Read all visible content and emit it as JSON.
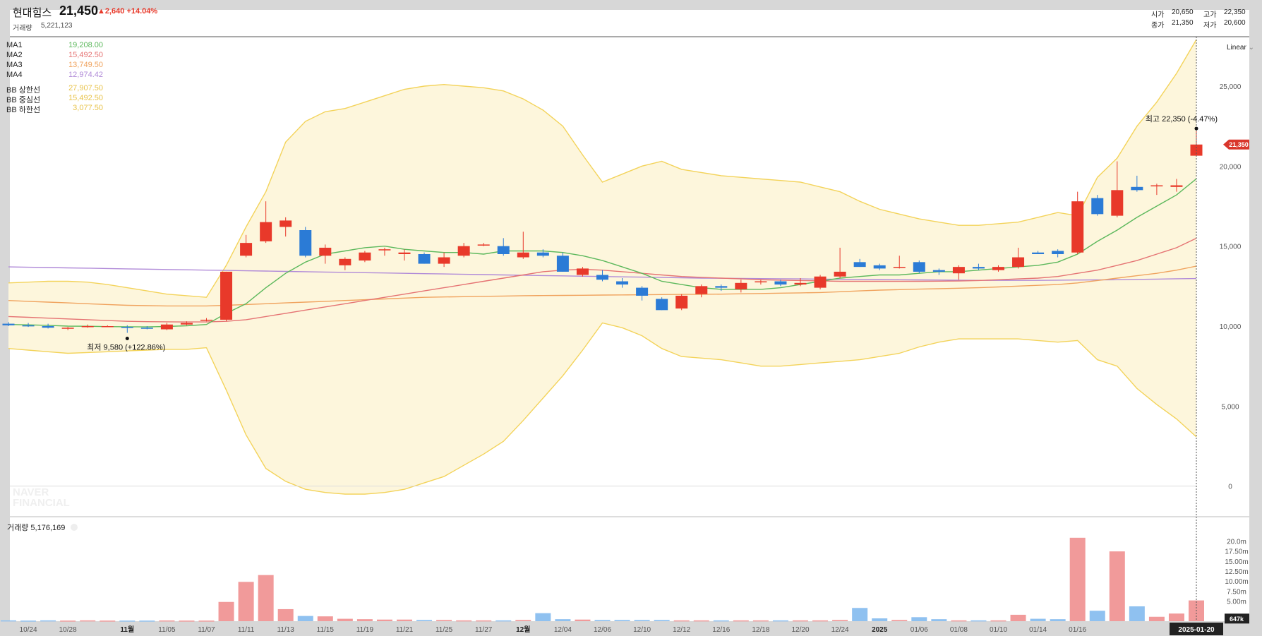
{
  "header": {
    "name": "현대힘스",
    "price": "21,450",
    "change": "▲2,640 +14.04%",
    "volume_label": "거래량",
    "volume_value": "5,221,123",
    "ohlc": {
      "open_label": "시가",
      "open": "20,650",
      "high_label": "고가",
      "high": "22,350",
      "close_label": "종가",
      "close": "21,350",
      "low_label": "저가",
      "low": "20,600"
    },
    "scale_mode": "Linear"
  },
  "legend": [
    {
      "name": "MA1",
      "value": "19,208.00",
      "color": "#5cb85c"
    },
    {
      "name": "MA2",
      "value": "15,492.50",
      "color": "#e57373"
    },
    {
      "name": "MA3",
      "value": "13,749.50",
      "color": "#f0a35e"
    },
    {
      "name": "MA4",
      "value": "12,974.42",
      "color": "#b08ad8"
    },
    {
      "name": "BB 상한선",
      "value": "27,907.50",
      "color": "#e8c34a"
    },
    {
      "name": "BB 중심선",
      "value": "15,492.50",
      "color": "#e8c34a"
    },
    {
      "name": "BB 하한선",
      "value": "3,077.50",
      "color": "#e8c34a"
    }
  ],
  "annotations": {
    "high": "최고 22,350 (-4.47%)",
    "low": "최저 9,580 (+122.86%)",
    "last_price_tag": "21,350",
    "volume_tag": "647k",
    "date_tag": "2025-01-20"
  },
  "volume_panel_label": "거래량 5,176,169",
  "watermark": [
    "NAVER",
    "FINANCIAL"
  ],
  "colors": {
    "up": "#e8392a",
    "down": "#2b7bd6",
    "band_fill": "#fdf6dc",
    "band_line": "#f3d35a"
  },
  "chart_data": {
    "type": "candlestick",
    "price_axis": {
      "ylim": [
        -500,
        28000
      ],
      "ticks": [
        0,
        5000,
        10000,
        15000,
        20000,
        25000
      ],
      "tick_labels": [
        "0",
        "5,000",
        "10,000",
        "15,000",
        "20,000",
        "25,000"
      ]
    },
    "volume_axis": {
      "ylim": [
        0,
        22000000
      ],
      "ticks": [
        5000000,
        7500000,
        10000000,
        12500000,
        15000000,
        17500000,
        20000000
      ],
      "tick_labels": [
        "5.00m",
        "7.50m",
        "10.00m",
        "12.50m",
        "15.00m",
        "17.50m",
        "20.0m"
      ]
    },
    "x_tick_labels": [
      "10/24",
      "10/28",
      "11월",
      "11/05",
      "11/07",
      "11/11",
      "11/13",
      "11/15",
      "11/19",
      "11/21",
      "11/25",
      "11/27",
      "12월",
      "12/04",
      "12/06",
      "12/10",
      "12/12",
      "12/16",
      "12/18",
      "12/20",
      "12/24",
      "2025",
      "01/06",
      "01/08",
      "01/10",
      "01/14",
      "01/16"
    ],
    "x_tick_index": [
      1,
      3,
      6,
      8,
      10,
      12,
      14,
      16,
      18,
      20,
      22,
      24,
      26,
      28,
      30,
      32,
      34,
      36,
      38,
      40,
      42,
      44,
      46,
      48,
      50,
      52,
      54
    ],
    "candles": [
      {
        "o": 10150,
        "h": 10250,
        "l": 10000,
        "c": 10050
      },
      {
        "o": 10050,
        "h": 10200,
        "l": 9950,
        "c": 10000
      },
      {
        "o": 10000,
        "h": 10150,
        "l": 9850,
        "c": 9900
      },
      {
        "o": 9850,
        "h": 9950,
        "l": 9750,
        "c": 9900
      },
      {
        "o": 9950,
        "h": 10100,
        "l": 9900,
        "c": 10000
      },
      {
        "o": 10000,
        "h": 10050,
        "l": 9950,
        "c": 10000
      },
      {
        "o": 9950,
        "h": 10050,
        "l": 9580,
        "c": 9900
      },
      {
        "o": 9900,
        "h": 10000,
        "l": 9800,
        "c": 9850
      },
      {
        "o": 9800,
        "h": 10200,
        "l": 9750,
        "c": 10100
      },
      {
        "o": 10100,
        "h": 10300,
        "l": 10050,
        "c": 10200
      },
      {
        "o": 10400,
        "h": 10500,
        "l": 10300,
        "c": 10400
      },
      {
        "o": 10400,
        "h": 13400,
        "l": 10300,
        "c": 13400
      },
      {
        "o": 14400,
        "h": 15700,
        "l": 14300,
        "c": 15200
      },
      {
        "o": 15300,
        "h": 17800,
        "l": 15200,
        "c": 16500
      },
      {
        "o": 16200,
        "h": 16800,
        "l": 15600,
        "c": 16600
      },
      {
        "o": 16000,
        "h": 16200,
        "l": 14300,
        "c": 14400
      },
      {
        "o": 14400,
        "h": 15100,
        "l": 13900,
        "c": 14900
      },
      {
        "o": 13800,
        "h": 14300,
        "l": 13500,
        "c": 14200
      },
      {
        "o": 14100,
        "h": 14700,
        "l": 14000,
        "c": 14600
      },
      {
        "o": 14800,
        "h": 14900,
        "l": 14400,
        "c": 14800
      },
      {
        "o": 14500,
        "h": 14800,
        "l": 14100,
        "c": 14600
      },
      {
        "o": 14500,
        "h": 14600,
        "l": 13900,
        "c": 13900
      },
      {
        "o": 13900,
        "h": 14600,
        "l": 13700,
        "c": 14300
      },
      {
        "o": 14400,
        "h": 15200,
        "l": 14300,
        "c": 15000
      },
      {
        "o": 15100,
        "h": 15200,
        "l": 15000,
        "c": 15100
      },
      {
        "o": 15000,
        "h": 15500,
        "l": 14400,
        "c": 14500
      },
      {
        "o": 14300,
        "h": 15900,
        "l": 14200,
        "c": 14600
      },
      {
        "o": 14600,
        "h": 14800,
        "l": 14300,
        "c": 14400
      },
      {
        "o": 14400,
        "h": 14600,
        "l": 13400,
        "c": 13400
      },
      {
        "o": 13200,
        "h": 13700,
        "l": 13100,
        "c": 13600
      },
      {
        "o": 13200,
        "h": 13500,
        "l": 12800,
        "c": 12900
      },
      {
        "o": 12800,
        "h": 13000,
        "l": 12400,
        "c": 12600
      },
      {
        "o": 12400,
        "h": 12500,
        "l": 11600,
        "c": 11900
      },
      {
        "o": 11700,
        "h": 11800,
        "l": 11000,
        "c": 11000
      },
      {
        "o": 11100,
        "h": 12000,
        "l": 11000,
        "c": 11900
      },
      {
        "o": 12000,
        "h": 12600,
        "l": 11800,
        "c": 12500
      },
      {
        "o": 12500,
        "h": 12600,
        "l": 12200,
        "c": 12400
      },
      {
        "o": 12300,
        "h": 12900,
        "l": 12100,
        "c": 12700
      },
      {
        "o": 12800,
        "h": 12900,
        "l": 12600,
        "c": 12800
      },
      {
        "o": 12800,
        "h": 12900,
        "l": 12500,
        "c": 12600
      },
      {
        "o": 12600,
        "h": 13000,
        "l": 12500,
        "c": 12700
      },
      {
        "o": 12400,
        "h": 13200,
        "l": 12300,
        "c": 13100
      },
      {
        "o": 13100,
        "h": 14900,
        "l": 13000,
        "c": 13400
      },
      {
        "o": 14000,
        "h": 14200,
        "l": 13700,
        "c": 13700
      },
      {
        "o": 13800,
        "h": 13900,
        "l": 13500,
        "c": 13600
      },
      {
        "o": 13700,
        "h": 14400,
        "l": 13600,
        "c": 13700
      },
      {
        "o": 14000,
        "h": 14100,
        "l": 13300,
        "c": 13400
      },
      {
        "o": 13500,
        "h": 13600,
        "l": 13200,
        "c": 13400
      },
      {
        "o": 13300,
        "h": 13800,
        "l": 12900,
        "c": 13700
      },
      {
        "o": 13700,
        "h": 13900,
        "l": 13500,
        "c": 13600
      },
      {
        "o": 13500,
        "h": 13800,
        "l": 13400,
        "c": 13700
      },
      {
        "o": 13700,
        "h": 14900,
        "l": 13600,
        "c": 14300
      },
      {
        "o": 14600,
        "h": 14700,
        "l": 14500,
        "c": 14500
      },
      {
        "o": 14700,
        "h": 14800,
        "l": 14300,
        "c": 14500
      },
      {
        "o": 14600,
        "h": 18400,
        "l": 14500,
        "c": 17800
      },
      {
        "o": 18000,
        "h": 18200,
        "l": 16900,
        "c": 17000
      },
      {
        "o": 16900,
        "h": 20300,
        "l": 16800,
        "c": 18500
      },
      {
        "o": 18700,
        "h": 19400,
        "l": 18400,
        "c": 18500
      },
      {
        "o": 18800,
        "h": 18900,
        "l": 18200,
        "c": 18800
      },
      {
        "o": 18700,
        "h": 19200,
        "l": 18400,
        "c": 18800
      },
      {
        "o": 20650,
        "h": 22350,
        "l": 20600,
        "c": 21350
      }
    ],
    "volumes": [
      200000,
      150000,
      200000,
      150000,
      200000,
      150000,
      150000,
      150000,
      180000,
      150000,
      150000,
      4800000,
      9800000,
      11500000,
      3000000,
      1300000,
      1200000,
      600000,
      500000,
      400000,
      400000,
      300000,
      300000,
      200000,
      200000,
      200000,
      300000,
      2000000,
      500000,
      400000,
      300000,
      300000,
      300000,
      300000,
      200000,
      200000,
      200000,
      200000,
      200000,
      200000,
      200000,
      200000,
      300000,
      3300000,
      700000,
      300000,
      1000000,
      500000,
      200000,
      200000,
      200000,
      1600000,
      600000,
      500000,
      20800000,
      2600000,
      17400000,
      3700000,
      1100000,
      1900000,
      5176169
    ],
    "ma1": [
      10100,
      10080,
      10050,
      10000,
      9990,
      9970,
      9960,
      9950,
      9980,
      10020,
      10100,
      10800,
      11400,
      12400,
      13300,
      14000,
      14500,
      14700,
      14900,
      15000,
      14800,
      14700,
      14600,
      14600,
      14500,
      14700,
      14700,
      14700,
      14600,
      14400,
      14100,
      13700,
      13300,
      12800,
      12600,
      12400,
      12300,
      12300,
      12300,
      12400,
      12600,
      12800,
      13000,
      13100,
      13200,
      13200,
      13300,
      13400,
      13400,
      13500,
      13600,
      13700,
      13800,
      14000,
      14500,
      15300,
      16000,
      16800,
      17500,
      18200,
      19208
    ],
    "ma2": [
      10600,
      10550,
      10500,
      10450,
      10400,
      10350,
      10300,
      10280,
      10270,
      10260,
      10260,
      10300,
      10400,
      10600,
      10800,
      11000,
      11200,
      11400,
      11600,
      11800,
      12000,
      12200,
      12400,
      12600,
      12800,
      13000,
      13200,
      13400,
      13500,
      13550,
      13500,
      13400,
      13300,
      13200,
      13100,
      13050,
      13000,
      12950,
      12900,
      12870,
      12850,
      12830,
      12800,
      12800,
      12800,
      12800,
      12800,
      12810,
      12820,
      12850,
      12900,
      12950,
      13000,
      13100,
      13300,
      13500,
      13800,
      14100,
      14500,
      14900,
      15492
    ],
    "ma3": [
      11600,
      11550,
      11500,
      11450,
      11400,
      11350,
      11300,
      11280,
      11260,
      11260,
      11260,
      11300,
      11350,
      11400,
      11450,
      11500,
      11550,
      11600,
      11650,
      11700,
      11750,
      11800,
      11820,
      11840,
      11860,
      11880,
      11900,
      11910,
      11920,
      11930,
      11940,
      11950,
      11960,
      11970,
      11980,
      11990,
      12000,
      12020,
      12040,
      12060,
      12080,
      12100,
      12150,
      12200,
      12250,
      12280,
      12310,
      12340,
      12370,
      12400,
      12450,
      12500,
      12550,
      12600,
      12700,
      12850,
      13000,
      13150,
      13300,
      13500,
      13749
    ],
    "ma4": [
      13700,
      13680,
      13660,
      13640,
      13620,
      13600,
      13580,
      13560,
      13540,
      13520,
      13500,
      13480,
      13460,
      13440,
      13420,
      13400,
      13380,
      13360,
      13340,
      13320,
      13300,
      13280,
      13260,
      13240,
      13220,
      13200,
      13180,
      13160,
      13140,
      13120,
      13100,
      13080,
      13060,
      13040,
      13020,
      13000,
      12990,
      12980,
      12970,
      12960,
      12950,
      12940,
      12930,
      12920,
      12910,
      12900,
      12890,
      12880,
      12870,
      12860,
      12860,
      12860,
      12860,
      12870,
      12880,
      12890,
      12900,
      12920,
      12940,
      12960,
      12974
    ],
    "bb_upper": [
      12700,
      12750,
      12800,
      12800,
      12750,
      12600,
      12400,
      12200,
      12000,
      11900,
      11800,
      13800,
      16200,
      18400,
      21500,
      22800,
      23400,
      23600,
      24000,
      24400,
      24800,
      25000,
      25100,
      25000,
      24900,
      24700,
      24200,
      23500,
      22500,
      20700,
      19000,
      19500,
      20000,
      20300,
      19800,
      19600,
      19400,
      19300,
      19200,
      19100,
      19000,
      18700,
      18400,
      17800,
      17300,
      17000,
      16700,
      16500,
      16300,
      16300,
      16400,
      16500,
      16800,
      17100,
      16900,
      19300,
      20500,
      22500,
      24000,
      25800,
      27907
    ],
    "bb_lower": [
      8600,
      8500,
      8400,
      8300,
      8350,
      8400,
      8450,
      8500,
      8550,
      8550,
      8650,
      6000,
      3200,
      1100,
      300,
      -200,
      -400,
      -500,
      -500,
      -400,
      -200,
      200,
      600,
      1300,
      2000,
      2800,
      4100,
      5500,
      6900,
      8500,
      10200,
      9900,
      9400,
      8600,
      8100,
      8000,
      7900,
      7700,
      7500,
      7500,
      7600,
      7700,
      7800,
      7900,
      8100,
      8300,
      8700,
      9000,
      9200,
      9200,
      9200,
      9200,
      9100,
      9000,
      9100,
      7900,
      7500,
      6100,
      5100,
      4200,
      3077
    ]
  }
}
